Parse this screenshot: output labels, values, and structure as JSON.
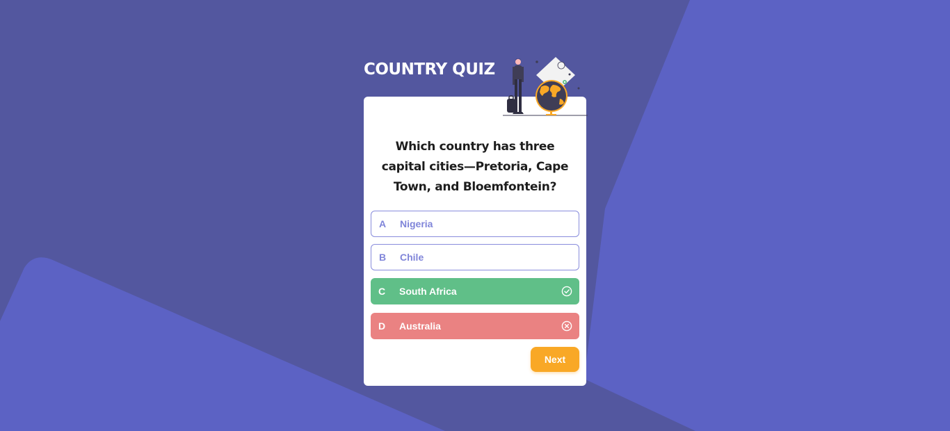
{
  "header": {
    "title": "COUNTRY QUIZ"
  },
  "quiz": {
    "question": "Which country has three capital cities—Pretoria, Cape Town, and Bloemfontein?",
    "options": [
      {
        "letter": "A",
        "text": "Nigeria",
        "state": "default"
      },
      {
        "letter": "B",
        "text": "Chile",
        "state": "default"
      },
      {
        "letter": "C",
        "text": "South Africa",
        "state": "correct",
        "icon": "check-circle-icon"
      },
      {
        "letter": "D",
        "text": "Australia",
        "state": "wrong",
        "icon": "x-circle-icon"
      }
    ],
    "next_label": "Next"
  },
  "colors": {
    "background": "#53579f",
    "background_accent": "#5c62c4",
    "correct": "#60bf88",
    "wrong": "#ea8282",
    "option_border": "#6066d0",
    "next_button": "#f9a826"
  }
}
